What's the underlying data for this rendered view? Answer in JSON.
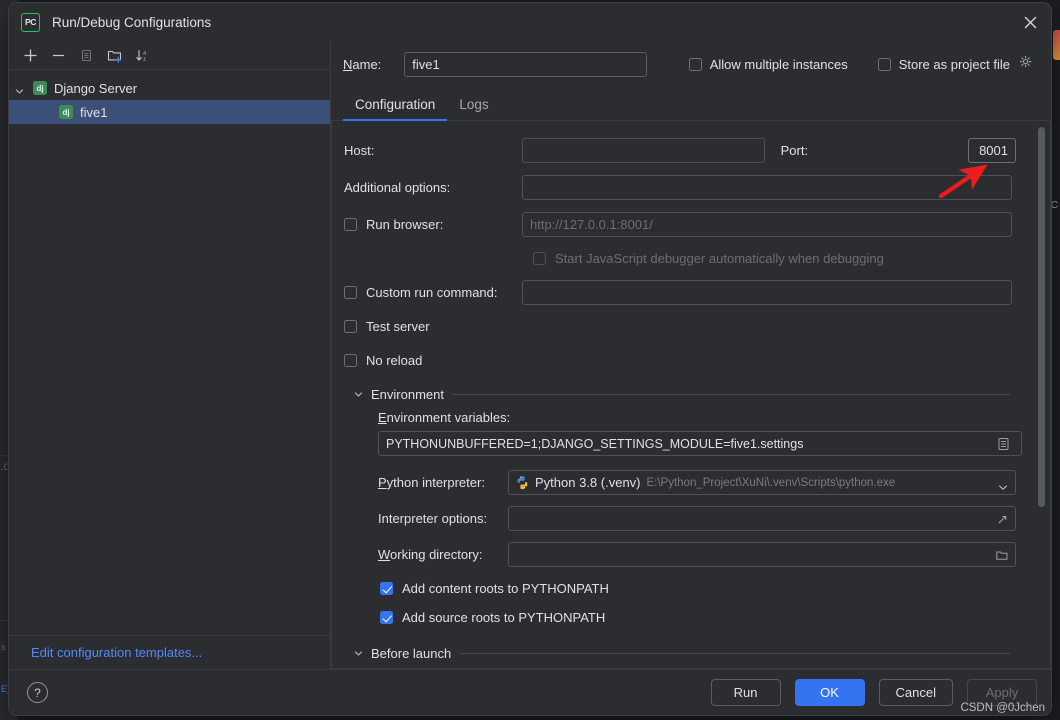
{
  "window": {
    "title": "Run/Debug Configurations",
    "logo_text": "PC",
    "close_label": "×"
  },
  "left_panel": {
    "toolbar": [
      {
        "name": "add-configuration-button",
        "icon": "plus-icon",
        "label": "+"
      },
      {
        "name": "remove-configuration-button",
        "icon": "minus-icon",
        "label": "−"
      },
      {
        "name": "copy-configuration-button",
        "icon": "copy-icon",
        "label": "Copy"
      },
      {
        "name": "new-folder-button",
        "icon": "folder-add-icon",
        "label": "New Folder"
      },
      {
        "name": "sort-configurations-button",
        "icon": "sort-alpha-icon",
        "label": "Sort"
      }
    ],
    "tree": [
      {
        "label": "Django Server",
        "icon": "django-icon",
        "icon_text": "dj",
        "level": 0,
        "selected": false,
        "expanded": true
      },
      {
        "label": "five1",
        "icon": "django-icon",
        "icon_text": "dj",
        "level": 1,
        "selected": true,
        "expanded": false
      }
    ],
    "footer_link": "Edit configuration templates..."
  },
  "header": {
    "name_label": "Name:",
    "name_value": "five1",
    "allow_multiple_instances": {
      "label": "Allow multiple instances",
      "checked": false
    },
    "store_as_project_file": {
      "label": "Store as project file",
      "checked": false,
      "gear_icon": "gear-icon"
    }
  },
  "tabs": [
    {
      "label": "Configuration",
      "active": true
    },
    {
      "label": "Logs",
      "active": false
    }
  ],
  "configuration": {
    "host": {
      "label": "Host:",
      "value": "",
      "placeholder": ""
    },
    "port": {
      "label": "Port:",
      "value": "8001"
    },
    "additional_options": {
      "label": "Additional options:",
      "value": ""
    },
    "run_browser": {
      "label": "Run browser:",
      "checked": false,
      "value": "",
      "placeholder": "http://127.0.0.1:8001/"
    },
    "start_js_debugger": {
      "label": "Start JavaScript debugger automatically when debugging",
      "checked": false,
      "disabled": true
    },
    "custom_run_command": {
      "label": "Custom run command:",
      "checked": false,
      "value": ""
    },
    "test_server": {
      "label": "Test server",
      "checked": false
    },
    "no_reload": {
      "label": "No reload",
      "checked": false
    },
    "environment": {
      "section_title": "Environment",
      "expanded": true,
      "env_vars_label": "Environment variables:",
      "env_vars_value": "PYTHONUNBUFFERED=1;DJANGO_SETTINGS_MODULE=five1.settings",
      "env_vars_button_icon": "edit-list-icon",
      "interpreter_label": "Python interpreter:",
      "interpreter_name": "Python 3.8 (.venv)",
      "interpreter_path": "E:\\Python_Project\\XuNi\\.venv\\Scripts\\python.exe",
      "interpreter_icon": "python-icon",
      "interpreter_arrow_icon": "chevron-down-icon",
      "interpreter_options_label": "Interpreter options:",
      "interpreter_options_value": "",
      "interpreter_options_icon": "expand-icon",
      "working_directory_label": "Working directory:",
      "working_directory_value": "",
      "working_directory_icon": "folder-icon",
      "add_content_roots": {
        "label": "Add content roots to PYTHONPATH",
        "checked": true
      },
      "add_source_roots": {
        "label": "Add source roots to PYTHONPATH",
        "checked": true
      }
    },
    "before_launch": {
      "section_title": "Before launch",
      "expanded": true
    }
  },
  "footer": {
    "help_icon": "question-mark-icon",
    "buttons": [
      {
        "label": "Run",
        "name": "run-button",
        "style": "default"
      },
      {
        "label": "OK",
        "name": "ok-button",
        "style": "primary"
      },
      {
        "label": "Cancel",
        "name": "cancel-button",
        "style": "default"
      },
      {
        "label": "Apply",
        "name": "apply-button",
        "style": "disabled"
      }
    ]
  },
  "annotation": {
    "type": "red-arrow",
    "color": "#ee1c1c",
    "points_to": "port-field"
  },
  "watermark": "CSDN @0Jchen"
}
